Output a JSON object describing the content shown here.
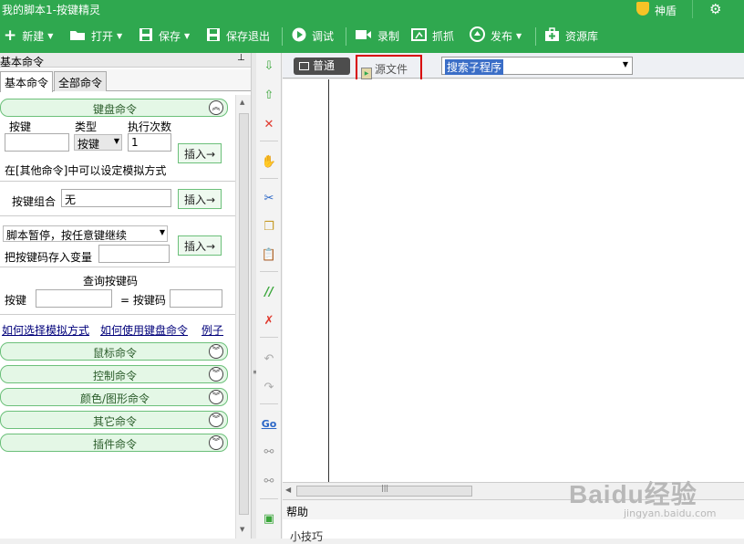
{
  "window": {
    "title": "我的脚本1-按键精灵",
    "shield_label": "神盾"
  },
  "toolbar": {
    "new": "新建",
    "open": "打开",
    "save": "保存",
    "save_exit": "保存退出",
    "debug": "调试",
    "record": "录制",
    "capture": "抓抓",
    "publish": "发布",
    "resources": "资源库"
  },
  "left_panel": {
    "header": "基本命令",
    "tabs": [
      "基本命令",
      "全部命令"
    ],
    "keyboard_section": {
      "title": "键盘命令",
      "col_key": "按键",
      "col_type": "类型",
      "col_count": "执行次数",
      "key_value": "",
      "type_value": "按键",
      "count_value": "1",
      "insert": "插入→",
      "hint": "在[其他命令]中可以设定模拟方式",
      "combo_label": "按键组合",
      "combo_value": "无",
      "pause_option": "脚本暂停，按任意键继续",
      "store_label": "把按键码存入变量",
      "store_value": "",
      "query_title": "查询按键码",
      "query_key_label": "按键",
      "query_key_value": "",
      "query_code_label": "= 按键码",
      "query_code_value": "",
      "links": [
        "如何选择模拟方式",
        "如何使用键盘命令",
        "例子"
      ]
    },
    "sections": [
      "鼠标命令",
      "控制命令",
      "颜色/图形命令",
      "其它命令",
      "插件命令"
    ]
  },
  "editor": {
    "mode_normal": "普通",
    "mode_source": "源文件",
    "sub_select": "搜索子程序",
    "help_label": "帮助",
    "help_text": "小技巧"
  },
  "watermark": {
    "brand": "Baidu经验",
    "url": "jingyan.baidu.com"
  },
  "colors": {
    "accent": "#2fa84f",
    "highlight_box": "#d80000"
  }
}
